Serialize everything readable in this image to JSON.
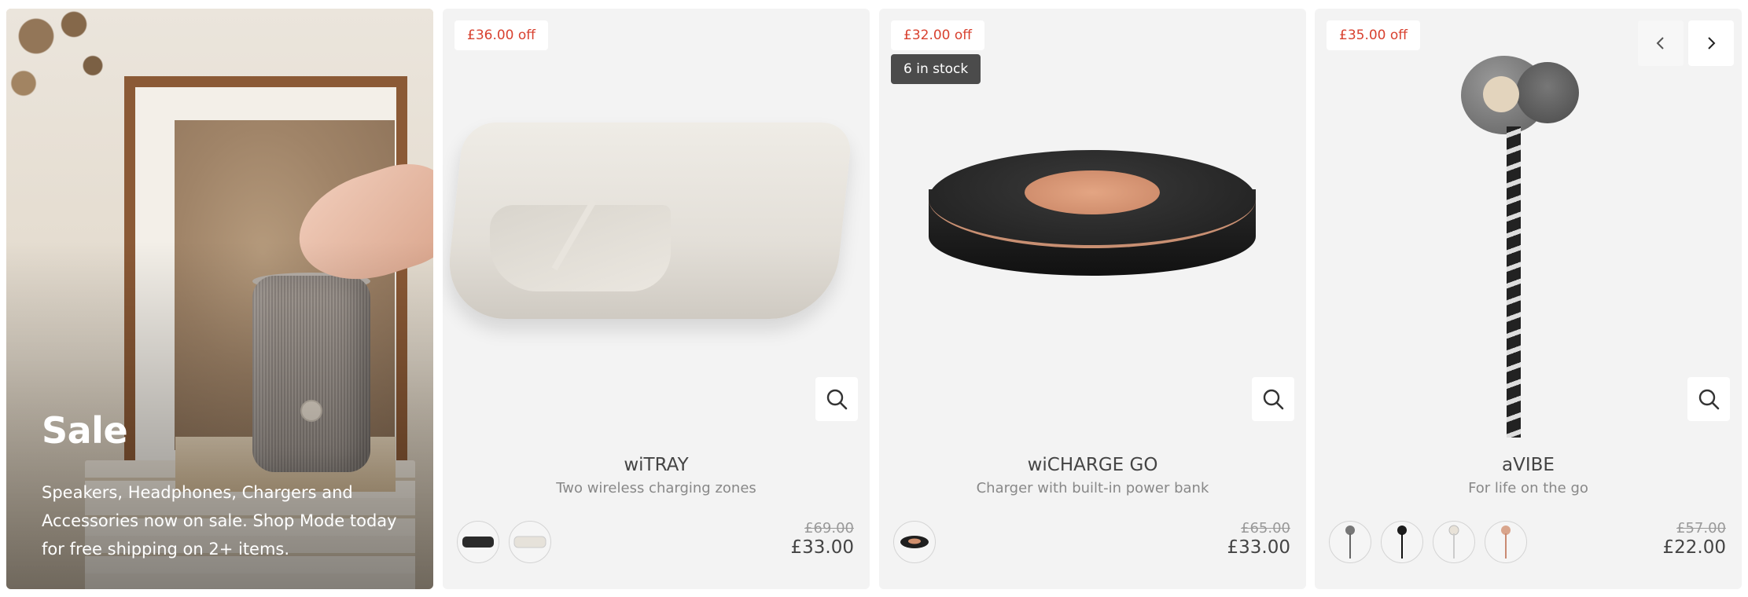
{
  "hero": {
    "title": "Sale",
    "text": "Speakers, Headphones, Chargers and Accessories now on sale. Shop Mode today for free shipping on 2+ items."
  },
  "carousel": {
    "prev_icon": "chevron-left-icon",
    "next_icon": "chevron-right-icon"
  },
  "products": [
    {
      "discount": "£36.00 off",
      "stock": "",
      "name": "wiTRAY",
      "description": "Two wireless charging zones",
      "old_price": "£69.00",
      "price": "£33.00",
      "swatches": [
        "black",
        "white"
      ],
      "quick_view_icon": "search-icon"
    },
    {
      "discount": "£32.00 off",
      "stock": "6 in stock",
      "name": "wiCHARGE GO",
      "description": "Charger with built-in power bank",
      "old_price": "£65.00",
      "price": "£33.00",
      "swatches": [
        "black"
      ],
      "quick_view_icon": "search-icon"
    },
    {
      "discount": "£35.00 off",
      "stock": "",
      "name": "aVIBE",
      "description": "For life on the go",
      "old_price": "£57.00",
      "price": "£22.00",
      "swatches": [
        "grey",
        "black",
        "white",
        "rose"
      ],
      "quick_view_icon": "search-icon"
    }
  ],
  "colors": {
    "discount_text": "#d8412f",
    "card_bg": "#f3f3f3",
    "stock_badge_bg": "#4b4b4b"
  }
}
